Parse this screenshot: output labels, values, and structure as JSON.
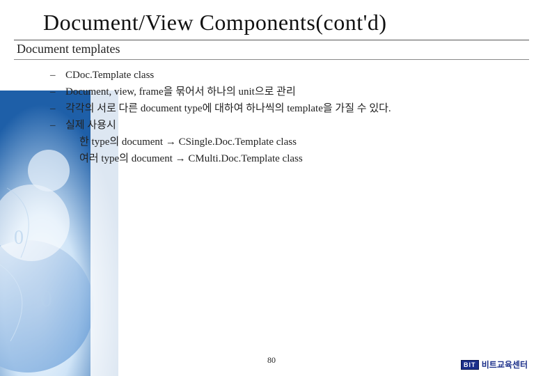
{
  "title": "Document/View Components(cont'd)",
  "subheading": "Document templates",
  "bullets": {
    "b0": "CDoc.Template class",
    "b1": "Document, view, frame을 묶어서 하나의 unit으로 관리",
    "b2": "각각의 서로 다른 document type에 대하여 하나씩의 template을 가질 수 있다.",
    "b3": "실제 사용시",
    "b3_sub1": "한 type의 document → CSingle.Doc.Template class",
    "b3_sub2": "여러 type의 document → CMulti.Doc.Template class"
  },
  "bullet_marker": "–",
  "page_number": "80",
  "logo": {
    "box": "BIT",
    "text": "비트교육센터"
  }
}
